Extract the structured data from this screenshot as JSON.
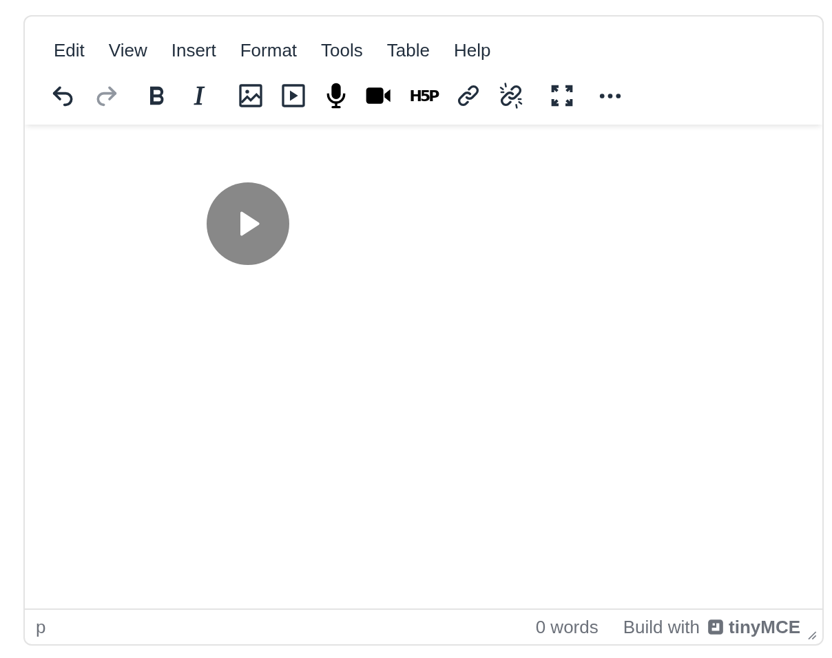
{
  "menubar": [
    "Edit",
    "View",
    "Insert",
    "Format",
    "Tools",
    "Table",
    "Help"
  ],
  "toolbar": [
    [
      {
        "kind": "undo",
        "disabled": false
      },
      {
        "kind": "redo",
        "disabled": true
      }
    ],
    [
      {
        "kind": "bold",
        "disabled": false
      },
      {
        "kind": "italic",
        "disabled": false
      }
    ],
    [
      {
        "kind": "image",
        "disabled": false
      },
      {
        "kind": "media",
        "disabled": false
      },
      {
        "kind": "audio",
        "disabled": false
      },
      {
        "kind": "video",
        "disabled": false
      },
      {
        "kind": "h5p",
        "disabled": false,
        "label": "H5P"
      },
      {
        "kind": "link",
        "disabled": false
      },
      {
        "kind": "unlink",
        "disabled": false
      }
    ],
    [
      {
        "kind": "fullscreen",
        "disabled": false
      }
    ],
    [
      {
        "kind": "more",
        "disabled": false
      }
    ]
  ],
  "status_bar": {
    "path": "p",
    "word_count": "0 words",
    "branding_prefix": "Build with",
    "branding": "tinyMCE"
  }
}
